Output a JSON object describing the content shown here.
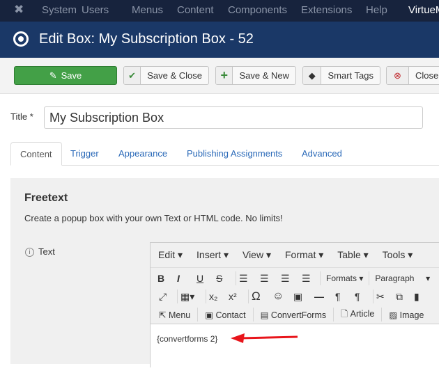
{
  "topnav": {
    "items": [
      "System",
      "Users",
      "Menus",
      "Content",
      "Components",
      "Extensions",
      "Help",
      "VirtueM"
    ]
  },
  "header": {
    "title": "Edit Box: My Subscription Box - 52"
  },
  "toolbar": {
    "save": "Save",
    "save_close": "Save & Close",
    "save_new": "Save & New",
    "smart_tags": "Smart Tags",
    "close": "Close"
  },
  "form": {
    "title_label": "Title *",
    "title_value": "My Subscription Box"
  },
  "tabs": [
    "Content",
    "Trigger",
    "Appearance",
    "Publishing Assignments",
    "Advanced"
  ],
  "panel": {
    "heading": "Freetext",
    "description": "Create a popup box with your own Text or HTML code. No limits!",
    "text_label": "Text"
  },
  "editor": {
    "menus": [
      "Edit",
      "Insert",
      "View",
      "Format",
      "Table",
      "Tools"
    ],
    "formats": "Formats",
    "block": "Paragraph",
    "buttons": [
      "Menu",
      "Contact",
      "ConvertForms",
      "Article",
      "Image"
    ],
    "content": "{convertforms 2}"
  },
  "colors": {
    "save": "#43a047",
    "header": "#1a3867",
    "topnav": "#17233d",
    "arrow": "#e8151b"
  }
}
